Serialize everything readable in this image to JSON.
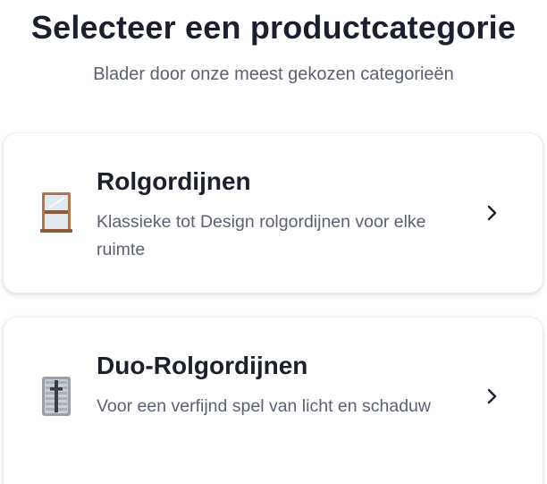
{
  "header": {
    "title": "Selecteer een productcategorie",
    "subtitle": "Blader door onze meest gekozen categorieën"
  },
  "categories": [
    {
      "title": "Rolgordijnen",
      "description": "Klassieke tot Design rolgordijnen voor elke ruimte",
      "icon": "window-icon"
    },
    {
      "title": "Duo-Rolgordijnen",
      "description": "Voor een verfijnd spel van licht en schaduw",
      "icon": "blinds-icon"
    }
  ],
  "colors": {
    "text_primary": "#1b1f2e",
    "text_secondary": "#5b6170",
    "card_border": "#eceef2",
    "window_frame": "#b0754f"
  }
}
